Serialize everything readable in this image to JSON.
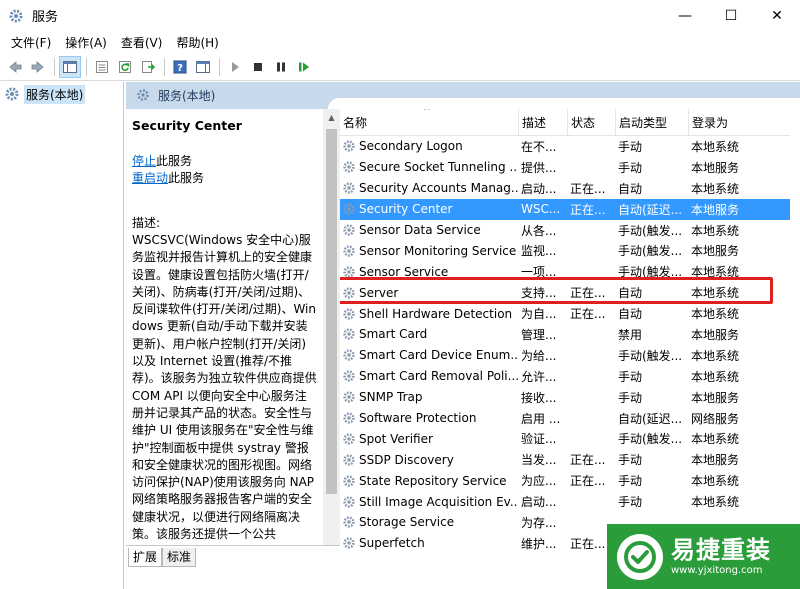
{
  "window": {
    "title": "服务",
    "minimize_glyph": "—",
    "maximize_glyph": "☐",
    "close_glyph": "✕"
  },
  "menu": [
    "文件(F)",
    "操作(A)",
    "查看(V)",
    "帮助(H)"
  ],
  "toolbar": {
    "icons": [
      "back-icon",
      "forward-icon",
      "show-hide-console-tree-icon",
      "properties-icon",
      "refresh-icon",
      "export-list-icon",
      "help-icon",
      "show-action-pane-icon",
      "start-service-icon",
      "stop-service-icon",
      "pause-service-icon",
      "restart-service-icon"
    ]
  },
  "tree": {
    "root_label": "服务(本地)"
  },
  "content_header": {
    "title": "服务(本地)"
  },
  "details": {
    "service_name": "Security Center",
    "stop_link": "停止",
    "stop_suffix": "此服务",
    "restart_link": "重启动",
    "restart_suffix": "此服务",
    "description_label": "描述:",
    "description_text": "WSCSVC(Windows 安全中心)服务监视并报告计算机上的安全健康设置。健康设置包括防火墙(打开/关闭)、防病毒(打开/关闭/过期)、反间谍软件(打开/关闭/过期)、Windows 更新(自动/手动下载并安装更新)、用户帐户控制(打开/关闭)以及 Internet 设置(推荐/不推荐)。该服务为独立软件供应商提供 COM API 以便向安全中心服务注册并记录其产品的状态。安全性与维护 UI 使用该服务在\"安全性与维护\"控制面板中提供 systray 警报和安全健康状况的图形视图。网络访问保护(NAP)使用该服务向 NAP 网络策略服务器报告客户端的安全健康状况，以便进行网络隔离决策。该服务还提供一个公共"
  },
  "tabs": [
    "扩展",
    "标准"
  ],
  "columns": {
    "name": "名称",
    "desc": "描述",
    "status": "状态",
    "startup": "启动类型",
    "logon": "登录为",
    "sort_glyph": "^"
  },
  "services": [
    {
      "name": "Secondary Logon",
      "desc": "在不...",
      "status": "",
      "startup": "手动",
      "logon": "本地系统"
    },
    {
      "name": "Secure Socket Tunneling ...",
      "desc": "提供...",
      "status": "",
      "startup": "手动",
      "logon": "本地服务"
    },
    {
      "name": "Security Accounts Manag...",
      "desc": "启动...",
      "status": "正在...",
      "startup": "自动",
      "logon": "本地系统"
    },
    {
      "name": "Security Center",
      "desc": "WSC...",
      "status": "正在...",
      "startup": "自动(延迟...",
      "logon": "本地服务",
      "selected": true
    },
    {
      "name": "Sensor Data Service",
      "desc": "从各...",
      "status": "",
      "startup": "手动(触发...",
      "logon": "本地系统"
    },
    {
      "name": "Sensor Monitoring Service",
      "desc": "监视...",
      "status": "",
      "startup": "手动(触发...",
      "logon": "本地服务"
    },
    {
      "name": "Sensor Service",
      "desc": "一项...",
      "status": "",
      "startup": "手动(触发...",
      "logon": "本地系统"
    },
    {
      "name": "Server",
      "desc": "支持...",
      "status": "正在...",
      "startup": "自动",
      "logon": "本地系统"
    },
    {
      "name": "Shell Hardware Detection",
      "desc": "为自...",
      "status": "正在...",
      "startup": "自动",
      "logon": "本地系统"
    },
    {
      "name": "Smart Card",
      "desc": "管理...",
      "status": "",
      "startup": "禁用",
      "logon": "本地服务"
    },
    {
      "name": "Smart Card Device Enum...",
      "desc": "为给...",
      "status": "",
      "startup": "手动(触发...",
      "logon": "本地系统"
    },
    {
      "name": "Smart Card Removal Poli...",
      "desc": "允许...",
      "status": "",
      "startup": "手动",
      "logon": "本地系统"
    },
    {
      "name": "SNMP Trap",
      "desc": "接收...",
      "status": "",
      "startup": "手动",
      "logon": "本地服务"
    },
    {
      "name": "Software Protection",
      "desc": "启用 ...",
      "status": "",
      "startup": "自动(延迟...",
      "logon": "网络服务"
    },
    {
      "name": "Spot Verifier",
      "desc": "验证...",
      "status": "",
      "startup": "手动(触发...",
      "logon": "本地系统"
    },
    {
      "name": "SSDP Discovery",
      "desc": "当发...",
      "status": "正在...",
      "startup": "手动",
      "logon": "本地服务"
    },
    {
      "name": "State Repository Service",
      "desc": "为应...",
      "status": "正在...",
      "startup": "手动",
      "logon": "本地系统"
    },
    {
      "name": "Still Image Acquisition Ev...",
      "desc": "启动...",
      "status": "",
      "startup": "手动",
      "logon": "本地系统"
    },
    {
      "name": "Storage Service",
      "desc": "为存...",
      "status": "",
      "startup": "",
      "logon": ""
    },
    {
      "name": "Superfetch",
      "desc": "维护...",
      "status": "正在...",
      "startup": "",
      "logon": ""
    }
  ],
  "watermark": {
    "name": "易捷重装",
    "url": "www.yjxitong.com",
    "color": "#2a9d3a"
  },
  "colors": {
    "selection": "#3399ff",
    "highlight_box": "#e0201e",
    "header": "#c9d9ec",
    "link": "#0066cc"
  }
}
